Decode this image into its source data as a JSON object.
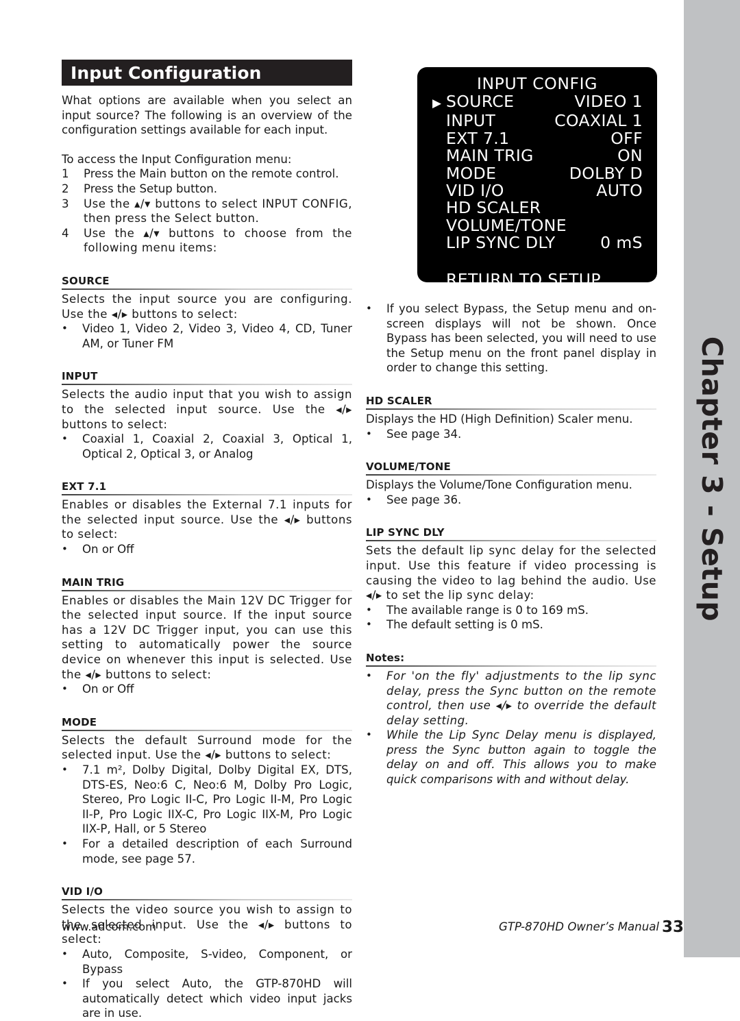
{
  "page": {
    "title": "Input Configuration",
    "chapter_tab": "Chapter 3 - Setup",
    "number": "33"
  },
  "intro": {
    "paragraph1": "What options are available when you select an input source? The following is an overview of the configuration settings available for each input.",
    "paragraph2": "To access the Input Configuration menu:",
    "steps": [
      {
        "num": "1",
        "text": "Press the Main button on the remote control."
      },
      {
        "num": "2",
        "text": "Press the Setup button."
      },
      {
        "num": "3",
        "text": "Use the ▴/▾ buttons to select INPUT CONFIG, then press the Select button."
      },
      {
        "num": "4",
        "text": "Use the ▴/▾ buttons to choose from the following menu items:"
      }
    ]
  },
  "osd": {
    "title": "INPUT CONFIG",
    "cursor_glyph": "▶",
    "rows": [
      {
        "label": "SOURCE",
        "value": "VIDEO 1",
        "selected": true
      },
      {
        "label": "INPUT",
        "value": "COAXIAL 1",
        "selected": false
      },
      {
        "label": "EXT 7.1",
        "value": "OFF",
        "selected": false
      },
      {
        "label": "MAIN TRIG",
        "value": "ON",
        "selected": false
      },
      {
        "label": "MODE",
        "value": "DOLBY D",
        "selected": false
      },
      {
        "label": "VID I/O",
        "value": "AUTO",
        "selected": false
      },
      {
        "label": "HD SCALER",
        "value": "",
        "selected": false
      },
      {
        "label": "VOLUME/TONE",
        "value": "",
        "selected": false
      },
      {
        "label": "LIP SYNC DLY",
        "value": "0 mS",
        "selected": false
      }
    ],
    "return_label": "RETURN TO SETUP"
  },
  "sections": {
    "source": {
      "heading": "SOURCE",
      "body": "Selects the input source you are configuring. Use the ◂/▸ buttons to select:",
      "bullets": [
        "Video 1, Video 2, Video 3, Video 4, CD, Tuner AM, or Tuner FM"
      ]
    },
    "input": {
      "heading": "INPUT",
      "body": "Selects the audio input that you wish to assign to the selected input source. Use the ◂/▸ buttons to select:",
      "bullets": [
        "Coaxial 1, Coaxial 2, Coaxial 3, Optical 1, Optical 2, Optical 3, or Analog"
      ]
    },
    "ext71": {
      "heading": "EXT 7.1",
      "body": "Enables or disables the External 7.1 inputs for the selected input source. Use the ◂/▸ buttons to select:",
      "bullets": [
        "On or Off"
      ]
    },
    "main_trig": {
      "heading": "MAIN TRIG",
      "body": "Enables or disables the Main 12V DC Trigger for the selected input source. If the input source has a 12V DC Trigger input, you can use this setting to automatically power the source device on whenever this input is selected. Use the ◂/▸ buttons to select:",
      "bullets": [
        "On or Off"
      ]
    },
    "mode": {
      "heading": "MODE",
      "body": "Selects the default Surround mode for the selected input. Use the ◂/▸ buttons to select:",
      "bullets": [
        "7.1 m², Dolby Digital, Dolby Digital EX, DTS, DTS-ES, Neo:6 C, Neo:6 M, Dolby Pro Logic, Stereo, Pro Logic II-C, Pro Logic II-M, Pro Logic II-P, Pro Logic IIX-C, Pro Logic IIX-M, Pro Logic IIX-P, Hall, or 5 Stereo",
        "For a detailed description of each Surround mode, see page 57."
      ]
    },
    "vid_io": {
      "heading": "VID I/O",
      "body": "Selects the video source you wish to assign to the selected input. Use the ◂/▸ buttons to select:",
      "bullets": [
        "Auto, Composite, S-video, Component, or Bypass",
        "If you select Auto, the GTP-870HD will automatically detect which video input jacks are in use."
      ]
    },
    "bypass_note": {
      "bullets": [
        "If you select Bypass, the Setup menu and on-screen displays will not be shown. Once Bypass has been selected, you will need to use the Setup menu on the front panel display in order to change this setting."
      ]
    },
    "hd_scaler": {
      "heading": "HD SCALER",
      "body": "Displays the HD (High Definition) Scaler menu.",
      "bullets": [
        "See page 34."
      ]
    },
    "volume_tone": {
      "heading": "VOLUME/TONE",
      "body": "Displays the Volume/Tone Configuration menu.",
      "bullets": [
        "See page 36."
      ]
    },
    "lip_sync_dly": {
      "heading": "LIP SYNC DLY",
      "body": "Sets the default lip sync delay for the selected input. Use this feature if video processing is causing the video to lag behind the audio. Use ◂/▸ to set the lip sync delay:",
      "bullets": [
        "The available range is 0 to 169 mS.",
        "The default setting is 0 mS."
      ]
    },
    "notes": {
      "heading": "Notes:",
      "bullets": [
        "For 'on the fly' adjustments to the lip sync delay, press the Sync button on the remote control, then use ◂/▸ to override the default delay setting.",
        "While the Lip Sync Delay menu is displayed, press the Sync button again to toggle the delay on and off. This allows you to make quick comparisons with and without delay."
      ]
    }
  },
  "footer": {
    "url": "www.adcom.com",
    "manual": "GTP-870HD Owner’s Manual"
  }
}
